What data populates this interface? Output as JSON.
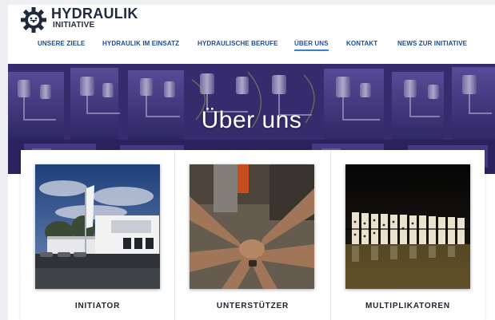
{
  "logo": {
    "title": "HYDRAULIK",
    "subtitle": "INITIATIVE",
    "icon": "gear-icon"
  },
  "nav": {
    "items": [
      {
        "label": "UNSERE ZIELE",
        "active": false
      },
      {
        "label": "HYDRAULIK IM EINSATZ",
        "active": false
      },
      {
        "label": "HYDRAULISCHE BERUFE",
        "active": false
      },
      {
        "label": "ÜBER UNS",
        "active": true
      },
      {
        "label": "KONTAKT",
        "active": false
      },
      {
        "label": "NEWS ZUR INITIATIVE",
        "active": false
      }
    ]
  },
  "hero": {
    "title": "Über uns"
  },
  "cards": [
    {
      "label": "INITIATOR"
    },
    {
      "label": "UNTERSTÜTZER"
    },
    {
      "label": "MULTIPLIKATOREN"
    }
  ],
  "colors": {
    "brand_dark": "#1f2a3d",
    "nav_link": "#1a4b9a",
    "nav_active_underline": "#3a7fd0",
    "hero_overlay": "#3b3070"
  }
}
